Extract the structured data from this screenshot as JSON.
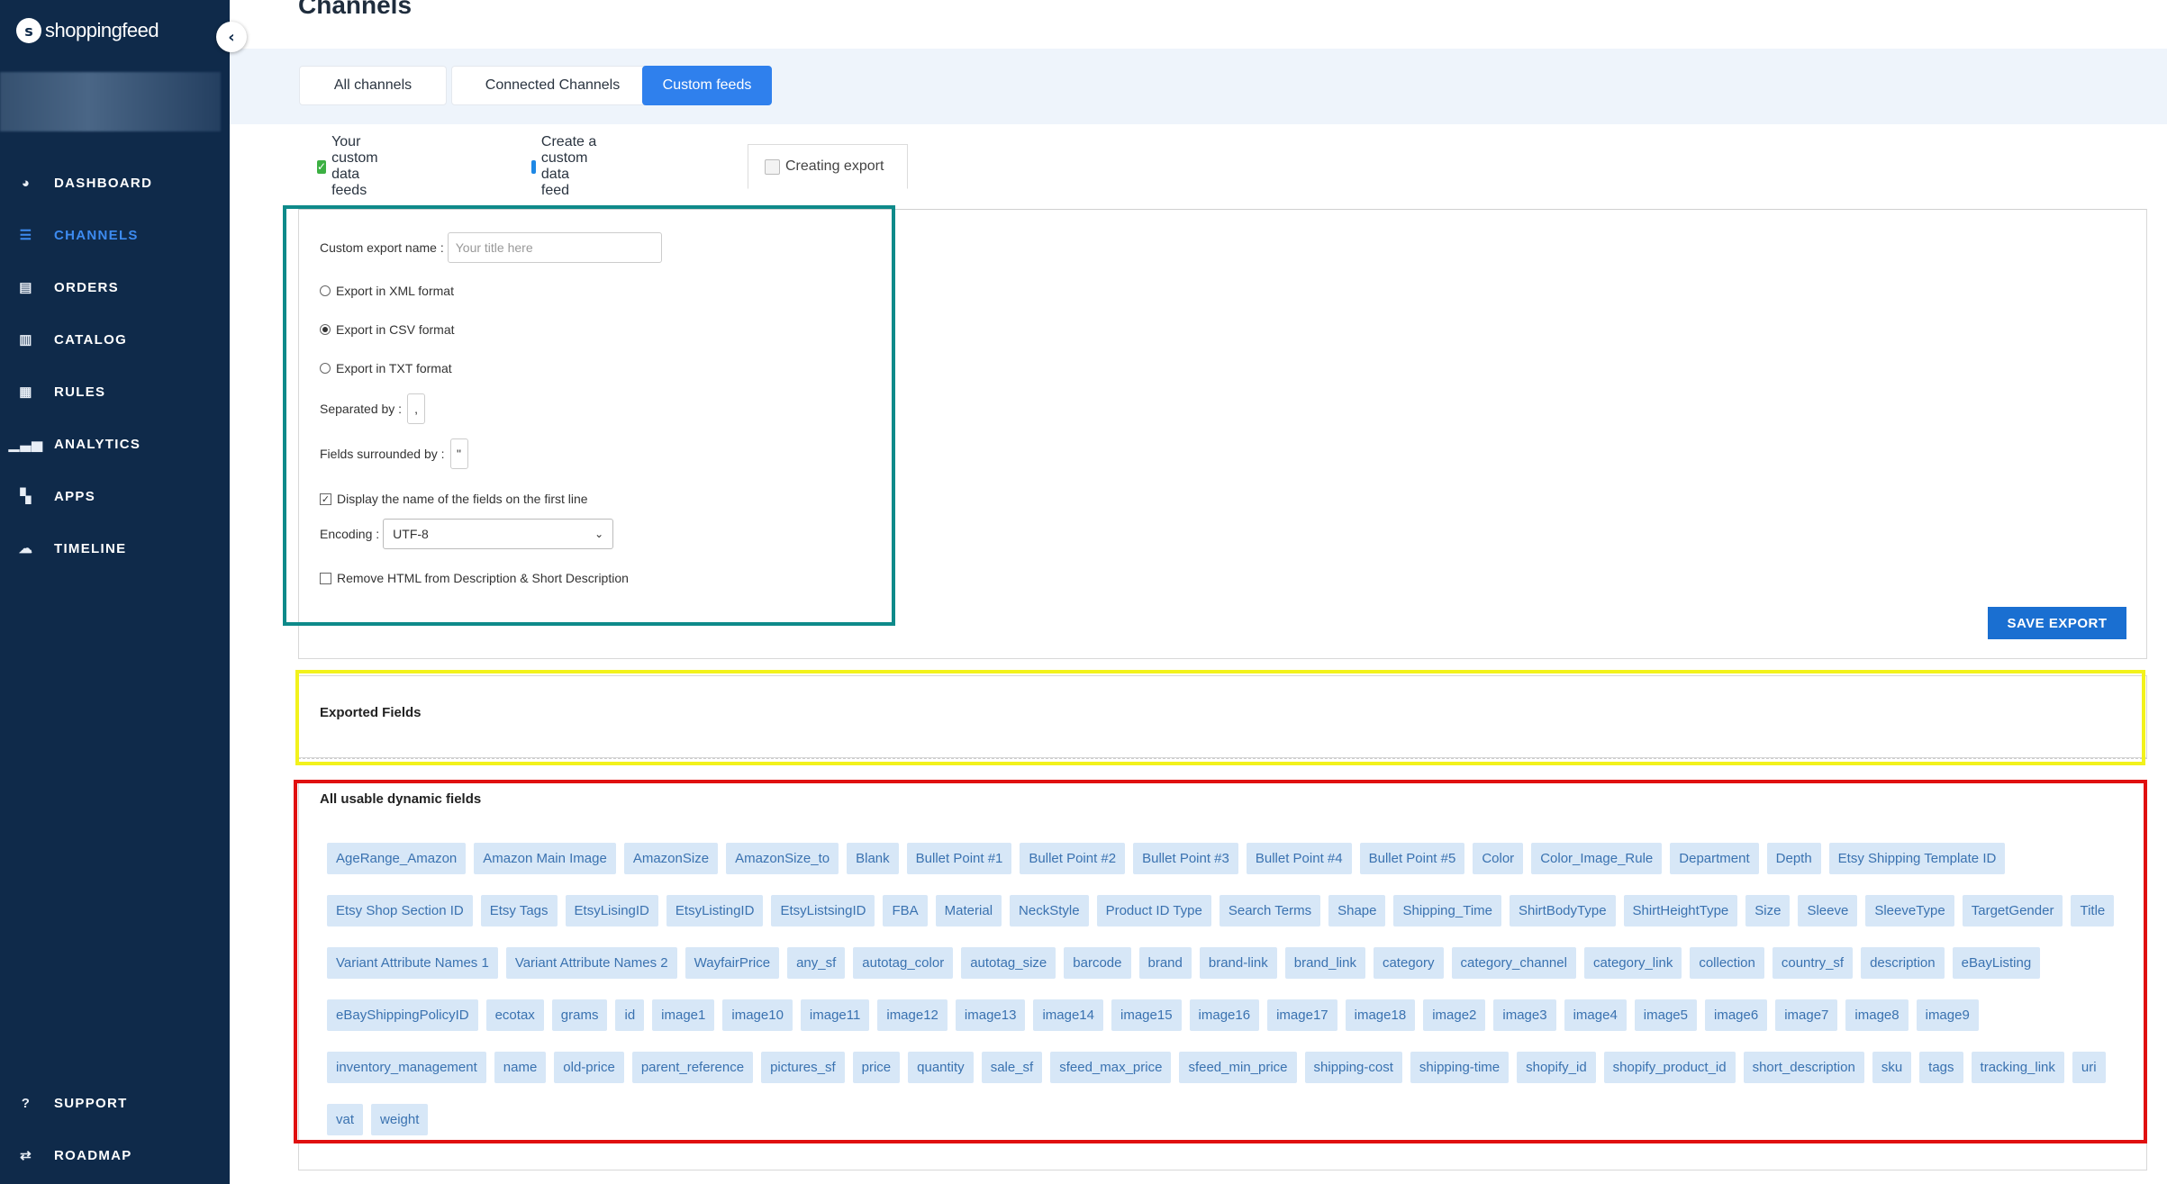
{
  "brand": {
    "name": "shoppingfeed"
  },
  "nav": {
    "items": [
      {
        "label": "DASHBOARD",
        "icon": "pie-chart-icon"
      },
      {
        "label": "CHANNELS",
        "icon": "list-icon"
      },
      {
        "label": "ORDERS",
        "icon": "document-icon"
      },
      {
        "label": "CATALOG",
        "icon": "book-icon"
      },
      {
        "label": "RULES",
        "icon": "clipboard-icon"
      },
      {
        "label": "ANALYTICS",
        "icon": "bar-chart-icon"
      },
      {
        "label": "APPS",
        "icon": "grid-icon"
      },
      {
        "label": "TIMELINE",
        "icon": "cloud-icon"
      }
    ],
    "bottom": [
      {
        "label": "SUPPORT",
        "icon": "question-icon"
      },
      {
        "label": "ROADMAP",
        "icon": "signpost-icon"
      }
    ]
  },
  "page": {
    "title": "Channels"
  },
  "tabs": [
    "All channels",
    "Connected Channels",
    "Custom feeds"
  ],
  "subtabs": [
    "Your custom data feeds",
    "Create a custom data feed",
    "Creating export"
  ],
  "form": {
    "name_label": "Custom export name :",
    "name_placeholder": "Your title here",
    "xml_label": "Export in XML format",
    "csv_label": "Export in CSV format",
    "txt_label": "Export in TXT format",
    "separator_label": "Separated by :",
    "separator_value": ",",
    "surround_label": "Fields surrounded by :",
    "surround_value": "\"",
    "first_line_label": "Display the name of the fields on the first line",
    "encoding_label": "Encoding :",
    "encoding_value": "UTF-8",
    "remove_html_label": "Remove HTML from Description & Short Description",
    "save_label": "SAVE EXPORT"
  },
  "exported": {
    "title": "Exported Fields"
  },
  "dynamic": {
    "title": "All usable dynamic fields",
    "fields": [
      "AgeRange_Amazon",
      "Amazon Main Image",
      "AmazonSize",
      "AmazonSize_to",
      "Blank",
      "Bullet Point #1",
      "Bullet Point #2",
      "Bullet Point #3",
      "Bullet Point #4",
      "Bullet Point #5",
      "Color",
      "Color_Image_Rule",
      "Department",
      "Depth",
      "Etsy Shipping Template ID",
      "Etsy Shop Section ID",
      "Etsy Tags",
      "EtsyLisingID",
      "EtsyListingID",
      "EtsyListsingID",
      "FBA",
      "Material",
      "NeckStyle",
      "Product ID Type",
      "Search Terms",
      "Shape",
      "Shipping_Time",
      "ShirtBodyType",
      "ShirtHeightType",
      "Size",
      "Sleeve",
      "SleeveType",
      "TargetGender",
      "Title",
      "Variant Attribute Names 1",
      "Variant Attribute Names 2",
      "WayfairPrice",
      "any_sf",
      "autotag_color",
      "autotag_size",
      "barcode",
      "brand",
      "brand-link",
      "brand_link",
      "category",
      "category_channel",
      "category_link",
      "collection",
      "country_sf",
      "description",
      "eBayListing",
      "eBayShippingPolicyID",
      "ecotax",
      "grams",
      "id",
      "image1",
      "image10",
      "image11",
      "image12",
      "image13",
      "image14",
      "image15",
      "image16",
      "image17",
      "image18",
      "image2",
      "image3",
      "image4",
      "image5",
      "image6",
      "image7",
      "image8",
      "image9",
      "inventory_management",
      "name",
      "old-price",
      "parent_reference",
      "pictures_sf",
      "price",
      "quantity",
      "sale_sf",
      "sfeed_max_price",
      "sfeed_min_price",
      "shipping-cost",
      "shipping-time",
      "shopify_id",
      "shopify_product_id",
      "short_description",
      "sku",
      "tags",
      "tracking_link",
      "uri",
      "vat",
      "weight"
    ]
  }
}
